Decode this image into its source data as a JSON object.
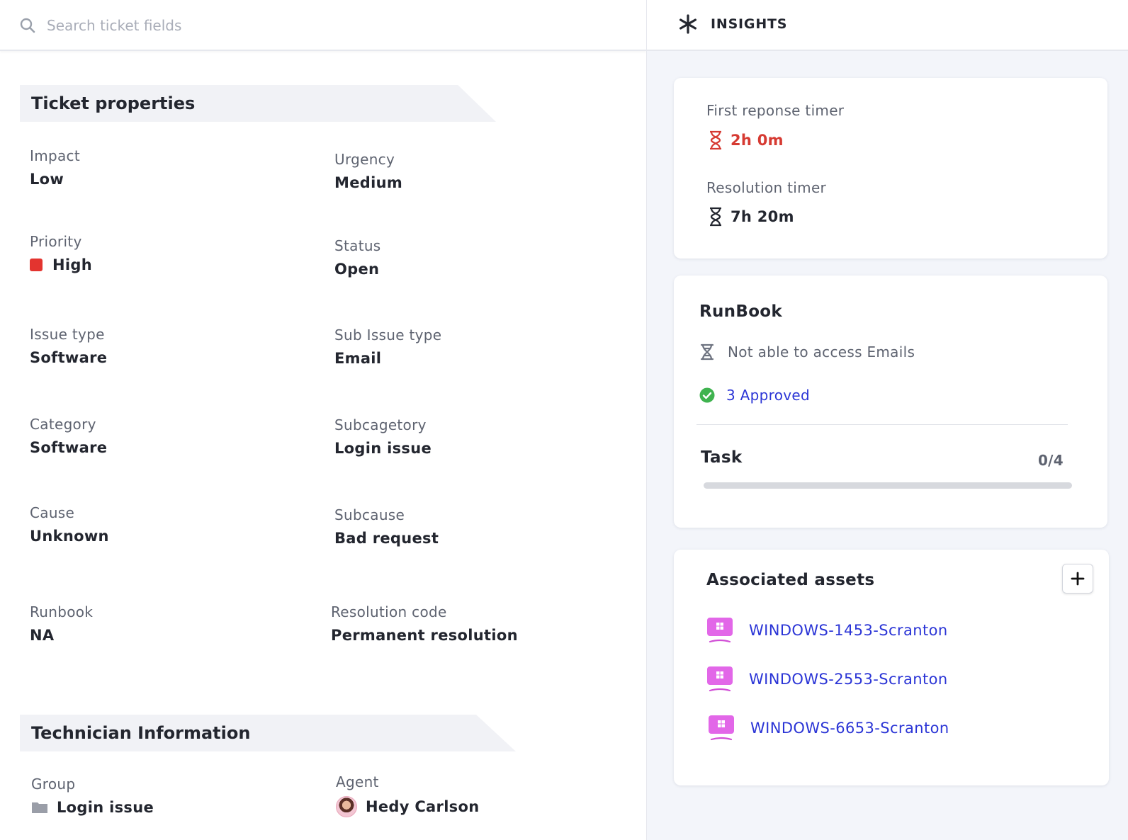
{
  "search": {
    "placeholder": "Search ticket fields"
  },
  "insights": {
    "title": "INSIGHTS",
    "icon": "asterisk-icon"
  },
  "ticket_properties": {
    "heading": "Ticket properties",
    "fields": {
      "impact": {
        "label": "Impact",
        "value": "Low"
      },
      "urgency": {
        "label": "Urgency",
        "value": "Medium"
      },
      "priority": {
        "label": "Priority",
        "value": "High",
        "color": "#e3342f"
      },
      "status": {
        "label": "Status",
        "value": "Open"
      },
      "issue_type": {
        "label": "Issue type",
        "value": "Software"
      },
      "sub_issue_type": {
        "label": "Sub Issue type",
        "value": "Email"
      },
      "category": {
        "label": "Category",
        "value": "Software"
      },
      "subcategory": {
        "label": "Subcagetory",
        "value": "Login issue"
      },
      "cause": {
        "label": "Cause",
        "value": "Unknown"
      },
      "subcause": {
        "label": "Subcause",
        "value": "Bad request"
      },
      "runbook": {
        "label": "Runbook",
        "value": "NA"
      },
      "resolution_code": {
        "label": "Resolution code",
        "value": "Permanent resolution"
      }
    }
  },
  "technician": {
    "heading": "Technician Information",
    "group": {
      "label": "Group",
      "value": "Login issue",
      "icon": "folder-icon"
    },
    "agent": {
      "label": "Agent",
      "value": "Hedy Carlson",
      "icon": "avatar"
    }
  },
  "timers": {
    "first_response": {
      "label": "First reponse timer",
      "value": "2h 0m",
      "color": "#d63a32"
    },
    "resolution": {
      "label": "Resolution timer",
      "value": "7h 20m"
    }
  },
  "runbook_card": {
    "title": "RunBook",
    "item": "Not able to access Emails",
    "approved": "3 Approved",
    "task_label": "Task",
    "task_count": "0/4",
    "task_progress": 0
  },
  "assets": {
    "title": "Associated assets",
    "items": [
      "WINDOWS-1453-Scranton",
      "WINDOWS-2553-Scranton",
      "WINDOWS-6653-Scranton"
    ]
  },
  "colors": {
    "accent": "#2b35d6",
    "danger": "#d63a32",
    "success": "#3fb34f",
    "asset": "#e267e8"
  }
}
